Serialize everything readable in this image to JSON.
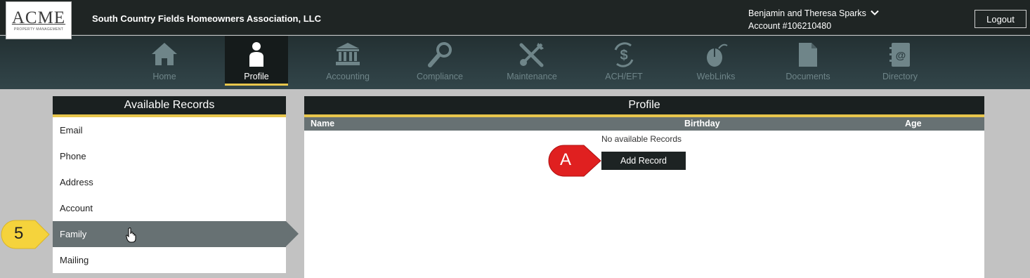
{
  "header": {
    "logo_text": "ACME",
    "logo_subtext": "PROPERTY MANAGEMENT",
    "association_name": "South Country Fields Homeowners Association, LLC",
    "user_name": "Benjamin and Theresa Sparks",
    "account": "Account #106210480",
    "logout_label": "Logout"
  },
  "nav": {
    "items": [
      {
        "label": "Home",
        "icon": "home-icon"
      },
      {
        "label": "Profile",
        "icon": "person-icon",
        "active": true
      },
      {
        "label": "Accounting",
        "icon": "bank-icon"
      },
      {
        "label": "Compliance",
        "icon": "magnifier-icon"
      },
      {
        "label": "Maintenance",
        "icon": "tools-icon"
      },
      {
        "label": "ACH/EFT",
        "icon": "dollar-cycle-icon"
      },
      {
        "label": "WebLinks",
        "icon": "mouse-icon"
      },
      {
        "label": "Documents",
        "icon": "document-icon"
      },
      {
        "label": "Directory",
        "icon": "address-book-icon"
      }
    ]
  },
  "available_records": {
    "title": "Available Records",
    "items": [
      "Email",
      "Phone",
      "Address",
      "Account",
      "Family",
      "Mailing"
    ],
    "selected": "Family"
  },
  "profile": {
    "title": "Profile",
    "columns": [
      "Name",
      "Birthday",
      "Age"
    ],
    "empty_message": "No available Records",
    "add_button_label": "Add Record"
  },
  "callouts": {
    "step_number": "5",
    "step_letter": "A",
    "step_number_color": "#f5d33c",
    "step_letter_color": "#e02020"
  },
  "colors": {
    "accent_gold": "#e8c64c",
    "header_dark": "#1f2524",
    "selected_row": "#677173"
  }
}
